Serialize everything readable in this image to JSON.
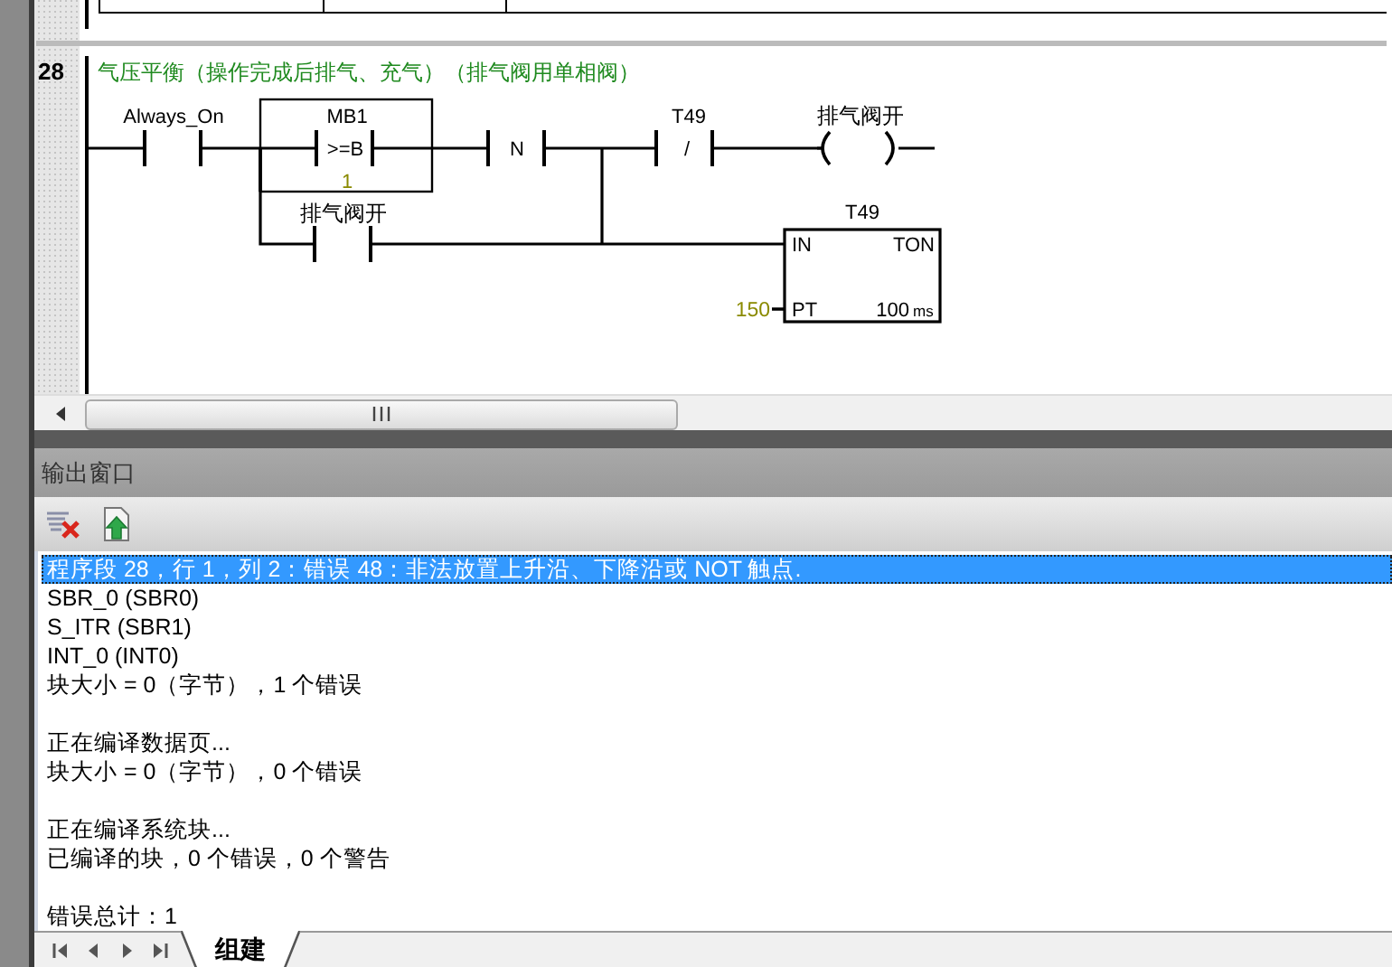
{
  "network": {
    "number": "28",
    "comment": "气压平衡（操作完成后排气、充气）（排气阀用单相阀）",
    "elements": [
      {
        "kind": "contact",
        "operand": "Always_On"
      },
      {
        "kind": "compare",
        "operand": "MB1",
        "operator": ">=B",
        "value": "1"
      },
      {
        "kind": "transition",
        "symbol": "N"
      },
      {
        "kind": "nc_contact",
        "operand": "T49",
        "symbol": "/"
      },
      {
        "kind": "coil",
        "operand": "排气阀开"
      },
      {
        "kind": "branch_contact",
        "operand": "排气阀开"
      },
      {
        "kind": "timer",
        "operand": "T49",
        "type": "TON",
        "in_label": "IN",
        "pt_label": "PT",
        "preset": "150",
        "base": "100",
        "unit": "ms"
      }
    ]
  },
  "output_window": {
    "title": "输出窗口",
    "message_groups": [
      [
        {
          "text": "程序段 28，行 1，列 2：错误 48：非法放置上升沿、下降沿或 NOT 触点.",
          "selected": true
        },
        {
          "text": "SBR_0 (SBR0)",
          "selected": false
        },
        {
          "text": "S_ITR (SBR1)",
          "selected": false
        },
        {
          "text": "INT_0 (INT0)",
          "selected": false
        },
        {
          "text": "块大小 = 0（字节），1 个错误",
          "selected": false
        }
      ],
      [
        {
          "text": "正在编译数据页...",
          "selected": false
        },
        {
          "text": "块大小 = 0（字节），0 个错误",
          "selected": false
        }
      ],
      [
        {
          "text": "正在编译系统块...",
          "selected": false
        },
        {
          "text": "已编译的块，0 个错误，0 个警告",
          "selected": false
        }
      ],
      [
        {
          "text": "错误总计：1",
          "selected": false
        }
      ]
    ],
    "tabs": [
      {
        "label": "组建",
        "selected": true
      }
    ]
  }
}
